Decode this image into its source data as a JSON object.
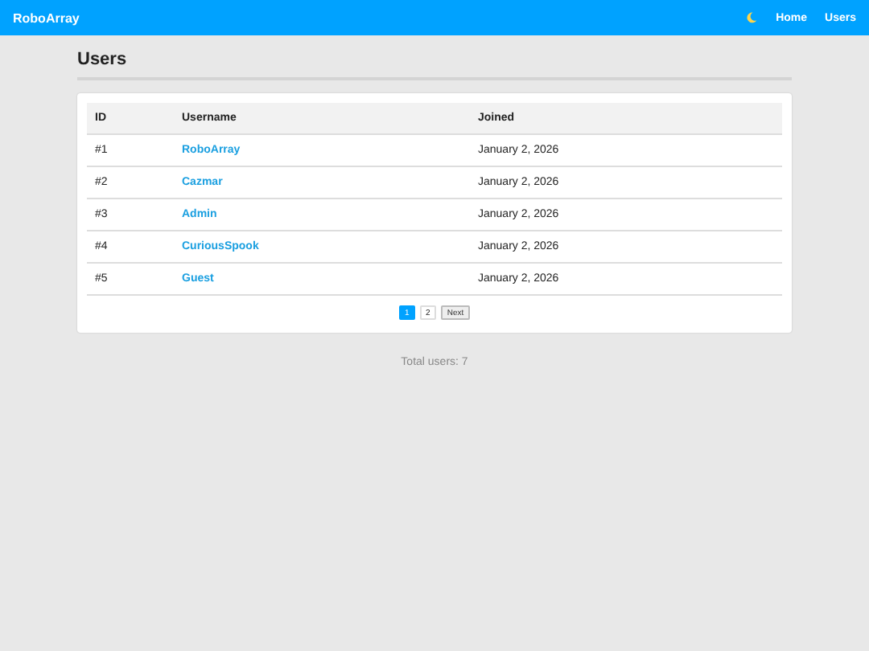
{
  "navbar": {
    "brand": "RoboArray",
    "links": [
      "Home",
      "Users"
    ]
  },
  "page_title": "Users",
  "table": {
    "columns": [
      "ID",
      "Username",
      "Joined"
    ],
    "rows": [
      {
        "id": "#1",
        "username": "RoboArray",
        "joined": "January 2, 2026"
      },
      {
        "id": "#2",
        "username": "Cazmar",
        "joined": "January 2, 2026"
      },
      {
        "id": "#3",
        "username": "Admin",
        "joined": "January 2, 2026"
      },
      {
        "id": "#4",
        "username": "CuriousSpook",
        "joined": "January 2, 2026"
      },
      {
        "id": "#5",
        "username": "Guest",
        "joined": "January 2, 2026"
      }
    ]
  },
  "pagination": {
    "pages": [
      {
        "label": "1",
        "selected": true
      },
      {
        "label": "2",
        "selected": false
      }
    ],
    "next": "Next"
  },
  "footer": "Total users: 7"
}
